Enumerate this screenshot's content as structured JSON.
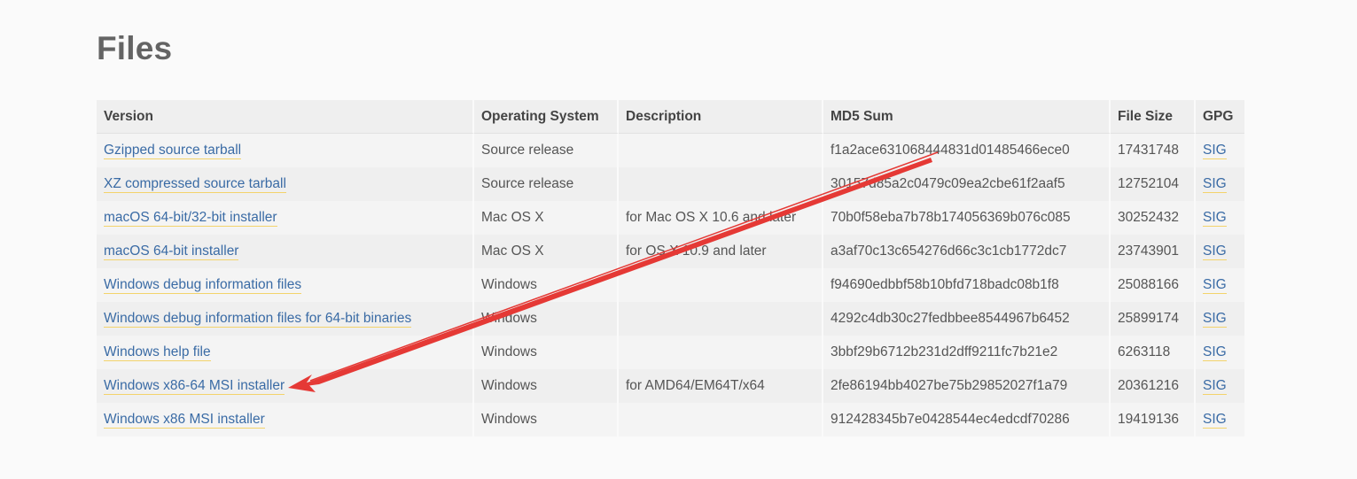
{
  "page": {
    "title": "Files"
  },
  "table": {
    "headers": {
      "version": "Version",
      "os": "Operating System",
      "description": "Description",
      "md5": "MD5 Sum",
      "size": "File Size",
      "gpg": "GPG"
    },
    "rows": [
      {
        "version": "Gzipped source tarball",
        "os": "Source release",
        "description": "",
        "md5": "f1a2ace631068444831d01485466ece0",
        "size": "17431748",
        "gpg": "SIG"
      },
      {
        "version": "XZ compressed source tarball",
        "os": "Source release",
        "description": "",
        "md5": "30157d85a2c0479c09ea2cbe61f2aaf5",
        "size": "12752104",
        "gpg": "SIG"
      },
      {
        "version": "macOS 64-bit/32-bit installer",
        "os": "Mac OS X",
        "description": "for Mac OS X 10.6 and later",
        "md5": "70b0f58eba7b78b174056369b076c085",
        "size": "30252432",
        "gpg": "SIG"
      },
      {
        "version": "macOS 64-bit installer",
        "os": "Mac OS X",
        "description": "for OS X 10.9 and later",
        "md5": "a3af70c13c654276d66c3c1cb1772dc7",
        "size": "23743901",
        "gpg": "SIG"
      },
      {
        "version": "Windows debug information files",
        "os": "Windows",
        "description": "",
        "md5": "f94690edbbf58b10bfd718badc08b1f8",
        "size": "25088166",
        "gpg": "SIG"
      },
      {
        "version": "Windows debug information files for 64-bit binaries",
        "os": "Windows",
        "description": "",
        "md5": "4292c4db30c27fedbbee8544967b6452",
        "size": "25899174",
        "gpg": "SIG"
      },
      {
        "version": "Windows help file",
        "os": "Windows",
        "description": "",
        "md5": "3bbf29b6712b231d2dff9211fc7b21e2",
        "size": "6263118",
        "gpg": "SIG"
      },
      {
        "version": "Windows x86-64 MSI installer",
        "os": "Windows",
        "description": "for AMD64/EM64T/x64",
        "md5": "2fe86194bb4027be75b29852027f1a79",
        "size": "20361216",
        "gpg": "SIG"
      },
      {
        "version": "Windows x86 MSI installer",
        "os": "Windows",
        "description": "",
        "md5": "912428345b7e0428544ec4edcdf70286",
        "size": "19419136",
        "gpg": "SIG"
      }
    ]
  },
  "annotation": {
    "color": "#e53935",
    "icon": "red-arrow-annotation"
  },
  "colors": {
    "link": "#3a6ba5",
    "link_underline": "#f3d36b",
    "header_bg": "#efefef",
    "page_bg": "#fafafa"
  }
}
